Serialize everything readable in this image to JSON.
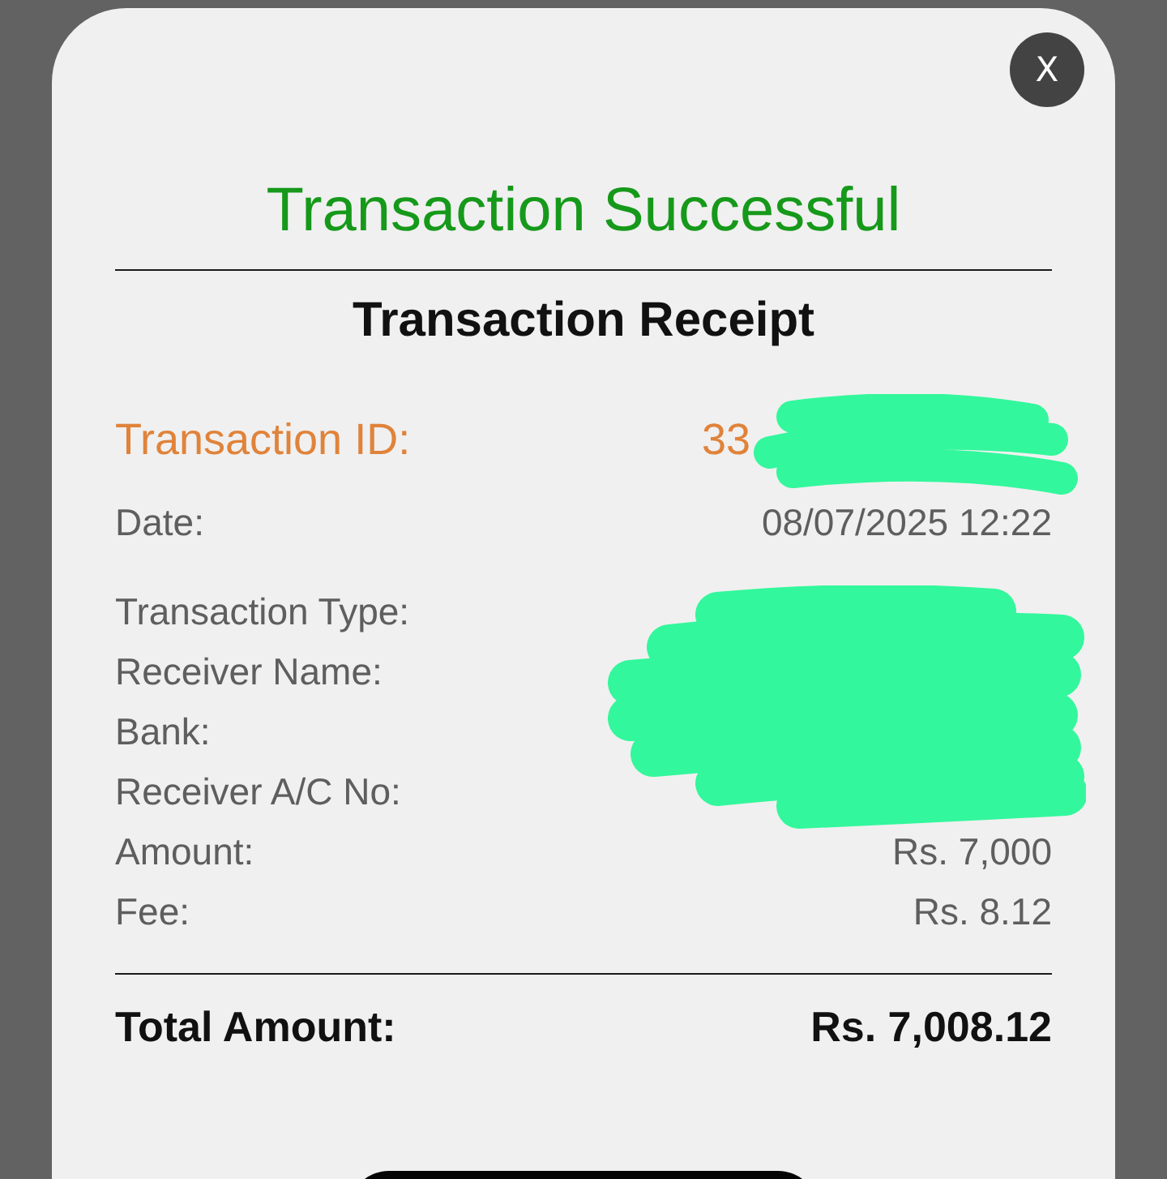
{
  "close_button": {
    "label": "X"
  },
  "status_title": "Transaction Successful",
  "receipt_title": "Transaction Receipt",
  "transaction_id": {
    "label": "Transaction ID:",
    "value": "33"
  },
  "date": {
    "label": "Date:",
    "value": "08/07/2025 12:22"
  },
  "details": [
    {
      "label": "Transaction Type:"
    },
    {
      "label": "Receiver Name:"
    },
    {
      "label": "Bank:"
    },
    {
      "label": "Receiver A/C No:"
    },
    {
      "label": "Amount:",
      "value": "Rs. 7,000"
    },
    {
      "label": "Fee:",
      "value": "Rs. 8.12"
    }
  ],
  "total": {
    "label": "Total Amount:",
    "value": "Rs. 7,008.12"
  }
}
